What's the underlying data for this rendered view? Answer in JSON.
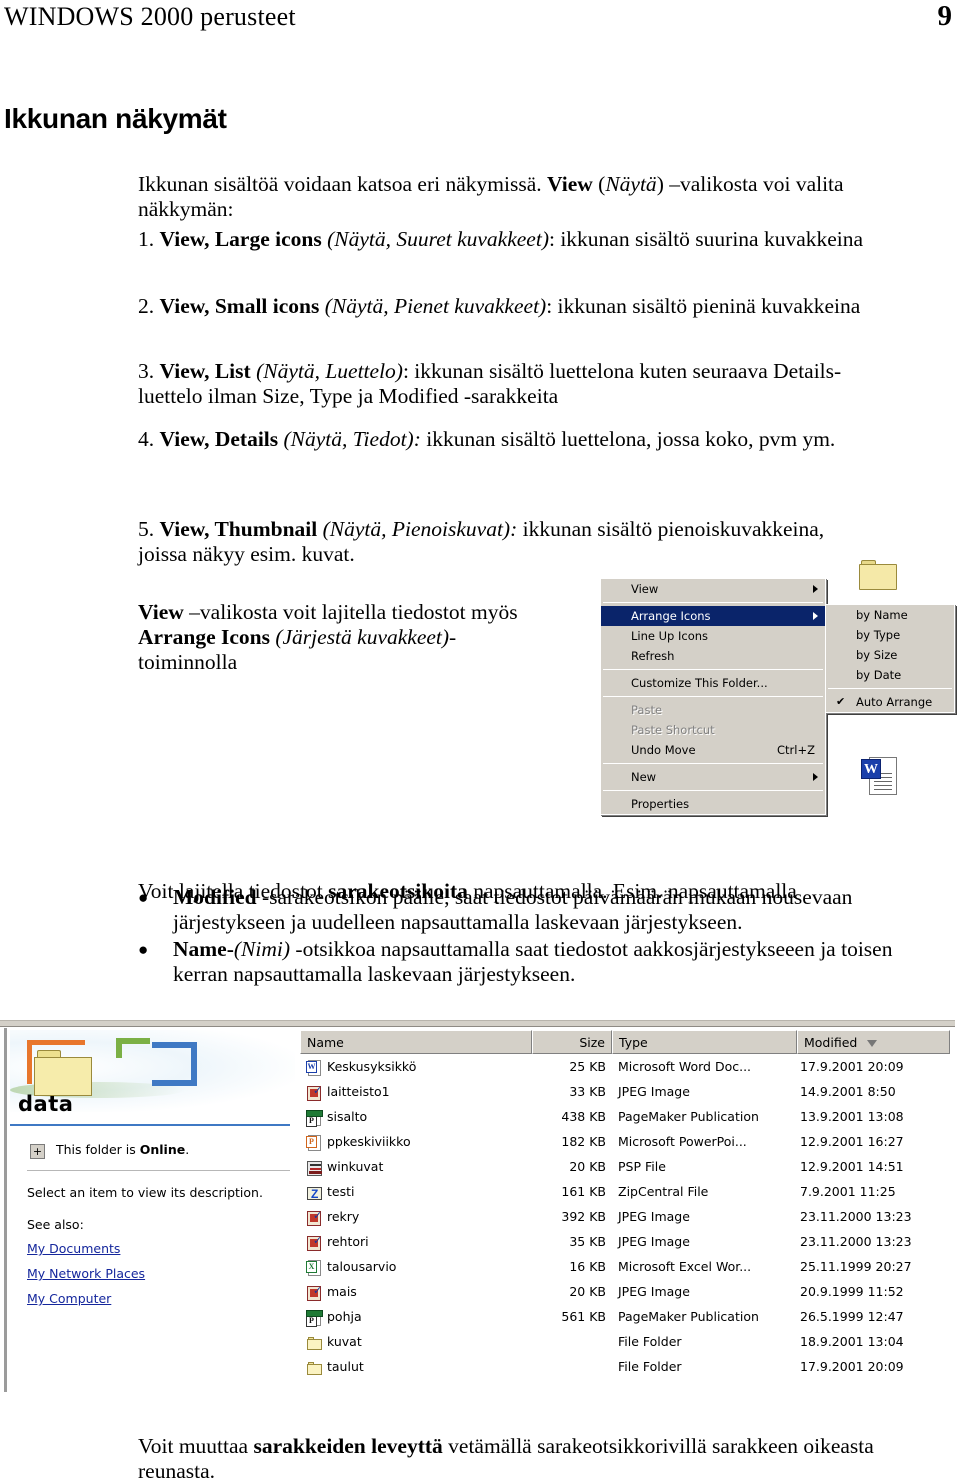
{
  "header": {
    "title": "WINDOWS 2000 perusteet",
    "page_number": "9"
  },
  "heading": "Ikkunan näkymät",
  "intro": {
    "line1_a": "Ikkunan sisältöä voidaan katsoa eri näkymissä. ",
    "line1_b": "View",
    "line1_c": " (",
    "line1_d": "Näytä",
    "line1_e": ") –valikosta voi valita",
    "line2": "näkkymän:"
  },
  "view_items": [
    {
      "number": "1.",
      "bold": "View, Large icons",
      "italic": "(Näytä, Suuret kuvakkeet)",
      "rest": ": ikkunan sisältö suurina kuvakkeina"
    },
    {
      "number": "2.",
      "bold": "View, Small icons",
      "italic": "(Näytä, Pienet kuvakkeet)",
      "rest": ": ikkunan sisältö pieninä kuvakkeina"
    },
    {
      "number": "3.",
      "bold": "View, List",
      "italic": "(Näytä, Luettelo)",
      "rest": ": ikkunan sisältö luettelona  kuten seuraava Details-",
      "line2": "luettelo ilman Size, Type ja Modified -sarakkeita"
    },
    {
      "number": "4.",
      "bold": "View, Details",
      "italic": "(Näytä, Tiedot):",
      "rest": " ikkunan sisältö luettelona, jossa koko, pvm ym."
    },
    {
      "number": "5.",
      "bold": "View, Thumbnail",
      "italic": "(Näytä, Pienoiskuvat):",
      "rest": " ikkunan sisältö pienoiskuvakkeina,",
      "line2": "joissa näkyy esim. kuvat."
    }
  ],
  "arrange_note": {
    "bold1": "View",
    "text1": " –valikosta voit lajitella tiedostot myös",
    "bold2": "Arrange Icons",
    "italic2": "(Järjestä kuvakkeet)-",
    "text3": "toiminnolla"
  },
  "context_menu": {
    "items": [
      {
        "label": "View",
        "submenu": true,
        "selected": false,
        "disabled": false,
        "accel": ""
      },
      {
        "label": "Arrange Icons",
        "submenu": true,
        "selected": true,
        "disabled": false,
        "accel": ""
      },
      {
        "label": "Line Up Icons",
        "submenu": false,
        "selected": false,
        "disabled": false,
        "accel": ""
      },
      {
        "label": "Refresh",
        "submenu": false,
        "selected": false,
        "disabled": false,
        "accel": ""
      },
      {
        "label": "Customize This Folder...",
        "submenu": false,
        "selected": false,
        "disabled": false,
        "accel": ""
      },
      {
        "label": "Paste",
        "submenu": false,
        "selected": false,
        "disabled": true,
        "accel": ""
      },
      {
        "label": "Paste Shortcut",
        "submenu": false,
        "selected": false,
        "disabled": true,
        "accel": ""
      },
      {
        "label": "Undo Move",
        "submenu": false,
        "selected": false,
        "disabled": false,
        "accel": "Ctrl+Z"
      },
      {
        "label": "New",
        "submenu": true,
        "selected": false,
        "disabled": false,
        "accel": ""
      },
      {
        "label": "Properties",
        "submenu": false,
        "selected": false,
        "disabled": false,
        "accel": ""
      }
    ],
    "submenu": {
      "items": [
        "by Name",
        "by Type",
        "by Size",
        "by Date"
      ],
      "checked_item": "Auto Arrange",
      "check_glyph": "✔"
    }
  },
  "sort_section": {
    "intro_a": "Voit lajitella tiedostot ",
    "intro_b": "sarakeotsikoita",
    "intro_c": " napsauttamalla. Esim. napsauttamalla",
    "bullets": [
      {
        "bold": "Modified",
        "text": " -sarakeotsikon päälle, saat tiedostot päivämäärän mukaan nousevaan järjestykseen ja uudelleen napsauttamalla laskevaan järjestykseen."
      },
      {
        "bold": "Name-",
        "italic": "(Nimi)",
        "text": " -otsikkoa napsauttamalla saat tiedostot aakkosjärjestykseeen ja toisen kerran napsauttamalla laskevaan järjestykseen."
      }
    ]
  },
  "explorer": {
    "folder_name": "data",
    "online_text_a": "This folder is ",
    "online_text_b": "Online",
    "online_text_c": ".",
    "plus_glyph": "+",
    "select_hint": "Select an item to view its description.",
    "see_also_label": "See also:",
    "links": [
      "My Documents",
      "My Network Places",
      "My Computer"
    ],
    "columns": [
      "Name",
      "Size",
      "Type",
      "Modified"
    ],
    "sort_column": "Modified",
    "rows": [
      {
        "icon": "word-file-icon",
        "name": "Keskusyksikkö",
        "size": "25 KB",
        "type": "Microsoft Word Doc...",
        "modified": "17.9.2001 20:09"
      },
      {
        "icon": "jpeg-file-icon",
        "name": "laitteisto1",
        "size": "33 KB",
        "type": "JPEG Image",
        "modified": "14.9.2001 8:50"
      },
      {
        "icon": "pagemaker-file-icon",
        "name": "sisalto",
        "size": "438 KB",
        "type": "PageMaker Publication",
        "modified": "13.9.2001 13:08"
      },
      {
        "icon": "powerpoint-file-icon",
        "name": "ppkeskiviikko",
        "size": "182 KB",
        "type": "Microsoft PowerPoi...",
        "modified": "12.9.2001 16:27"
      },
      {
        "icon": "psp-file-icon",
        "name": "winkuvat",
        "size": "20 KB",
        "type": "PSP File",
        "modified": "12.9.2001 14:51"
      },
      {
        "icon": "zip-file-icon",
        "name": "testi",
        "size": "161 KB",
        "type": "ZipCentral File",
        "modified": "7.9.2001 11:25"
      },
      {
        "icon": "jpeg-file-icon",
        "name": "rekry",
        "size": "392 KB",
        "type": "JPEG Image",
        "modified": "23.11.2000 13:23"
      },
      {
        "icon": "jpeg-file-icon",
        "name": "rehtori",
        "size": "35 KB",
        "type": "JPEG Image",
        "modified": "23.11.2000 13:23"
      },
      {
        "icon": "excel-file-icon",
        "name": "talousarvio",
        "size": "16 KB",
        "type": "Microsoft Excel Wor...",
        "modified": "25.11.1999 20:27"
      },
      {
        "icon": "jpeg-file-icon",
        "name": "mais",
        "size": "20 KB",
        "type": "JPEG Image",
        "modified": "20.9.1999 11:52"
      },
      {
        "icon": "pagemaker-file-icon",
        "name": "pohja",
        "size": "561 KB",
        "type": "PageMaker Publication",
        "modified": "26.5.1999 12:47"
      },
      {
        "icon": "folder-icon",
        "name": "kuvat",
        "size": "",
        "type": "File Folder",
        "modified": "18.9.2001 13:04"
      },
      {
        "icon": "folder-icon",
        "name": "taulut",
        "size": "",
        "type": "File Folder",
        "modified": "17.9.2001 20:09"
      }
    ]
  },
  "closing": {
    "a": "Voit muuttaa ",
    "b": "sarakkeiden leveyttä",
    "c": " vetämällä sarakeotsikkorivillä sarakkeen oikeasta reunasta."
  }
}
